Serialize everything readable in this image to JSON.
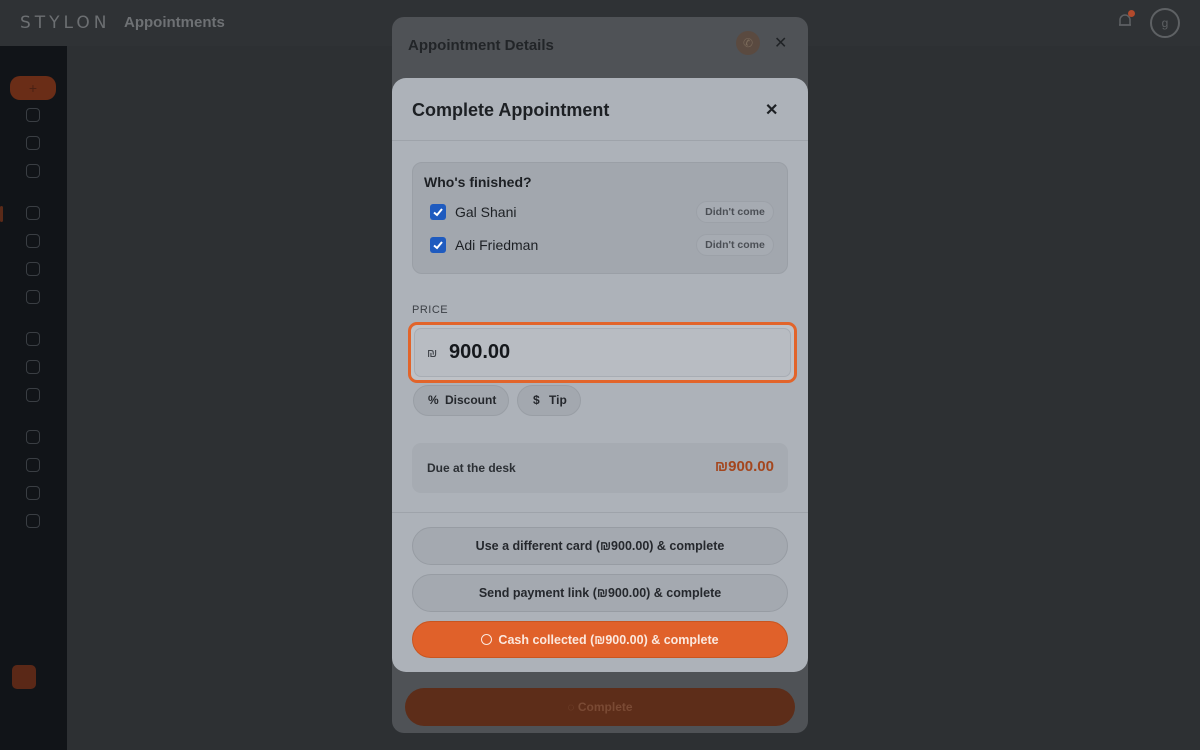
{
  "app": {
    "brand": "STYLON",
    "page_title": "Appointments",
    "avatar_initial": "g"
  },
  "background": {
    "details_title": "Appointment Details",
    "complete_label": "Complete"
  },
  "modal": {
    "title": "Complete Appointment",
    "who_title": "Who's finished?",
    "participants": [
      {
        "name": "Gal Shani",
        "checked": true,
        "no_show_label": "Didn't come"
      },
      {
        "name": "Adi Friedman",
        "checked": true,
        "no_show_label": "Didn't come"
      }
    ],
    "price_label": "PRICE",
    "currency_symbol": "₪",
    "price_value": "900.00",
    "discount_icon": "%",
    "discount_label": "Discount",
    "tip_icon": "$",
    "tip_label": "Tip",
    "due_label": "Due at the desk",
    "due_value": "₪900.00",
    "actions": {
      "different_card": "Use a different card (₪900.00) & complete",
      "payment_link": "Send payment link (₪900.00) & complete",
      "cash": "Cash collected (₪900.00) & complete"
    }
  },
  "colors": {
    "accent": "#e2642a",
    "checkbox": "#1f5bbf",
    "due_value": "#a4461d"
  }
}
